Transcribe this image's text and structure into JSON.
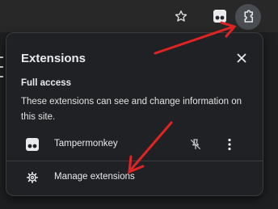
{
  "toolbar": {
    "icons": [
      "star-icon",
      "tampermonkey-icon",
      "puzzle-icon"
    ]
  },
  "popup": {
    "title": "Extensions",
    "close_icon": "close-icon",
    "section_heading": "Full access",
    "section_description": "These extensions can see and change information on this site.",
    "extensions": [
      {
        "name": "Tampermonkey",
        "icon": "tampermonkey-icon",
        "pin_icon": "pin-off-icon",
        "menu_icon": "more-vert-icon"
      }
    ],
    "manage": {
      "label": "Manage extensions",
      "icon": "gear-icon"
    }
  },
  "colors": {
    "toolbar_bg": "#282828",
    "popup_bg": "#202124",
    "text": "#e8eaed",
    "annotation_arrow": "#e02424"
  }
}
